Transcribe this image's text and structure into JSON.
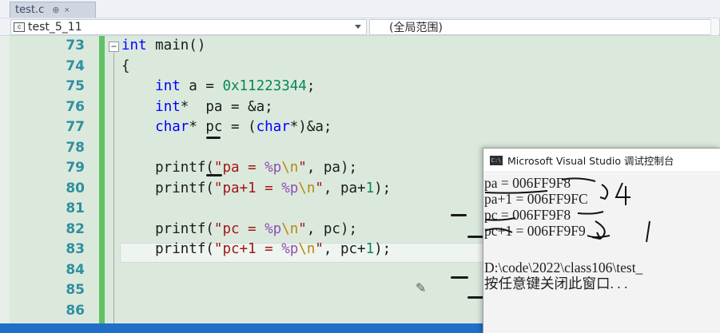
{
  "tab": {
    "title": "test.c",
    "pin_glyph": "⊕",
    "close_glyph": "×"
  },
  "nav": {
    "project": "test_5_11",
    "scope": "(全局范围)"
  },
  "editor": {
    "fold_glyph": "−",
    "lines": [
      {
        "number": "73",
        "code": "int main()"
      },
      {
        "number": "74",
        "code": "{"
      },
      {
        "number": "75",
        "code": "    int a = 0x11223344;"
      },
      {
        "number": "76",
        "code": "    int*  pa = &a;"
      },
      {
        "number": "77",
        "code": "    char* pc = (char*)&a;"
      },
      {
        "number": "78",
        "code": ""
      },
      {
        "number": "79",
        "code": "    printf(\"pa = %p\\n\", pa);"
      },
      {
        "number": "80",
        "code": "    printf(\"pa+1 = %p\\n\", pa+1);"
      },
      {
        "number": "81",
        "code": ""
      },
      {
        "number": "82",
        "code": "    printf(\"pc = %p\\n\", pc);"
      },
      {
        "number": "83",
        "code": "    printf(\"pc+1 = %p\\n\", pc+1);"
      },
      {
        "number": "84",
        "code": ""
      },
      {
        "number": "85",
        "code": ""
      },
      {
        "number": "86",
        "code": ""
      }
    ]
  },
  "console": {
    "icon_text": "C:\\",
    "title": "Microsoft Visual Studio 调试控制台",
    "output": [
      "pa = 006FF9F8",
      "pa+1 = 006FF9FC",
      "pc = 006FF9F8",
      "pc+1 = 006FF9F9",
      "",
      "D:\\code\\2022\\class106\\test_",
      "按任意键关闭此窗口. . ."
    ],
    "annotations": {
      "diff_pa": "4",
      "diff_pc": "1"
    }
  },
  "colors": {
    "editor_bg": "#dbe9dd",
    "line_number": "#2f8f9f",
    "keyword": "#0000ff",
    "string": "#a31515",
    "format_spec": "#8f4fb0",
    "escape": "#b8860b",
    "number": "#098658",
    "change_bar": "#62c062",
    "status_bar": "#1f6fc9"
  }
}
